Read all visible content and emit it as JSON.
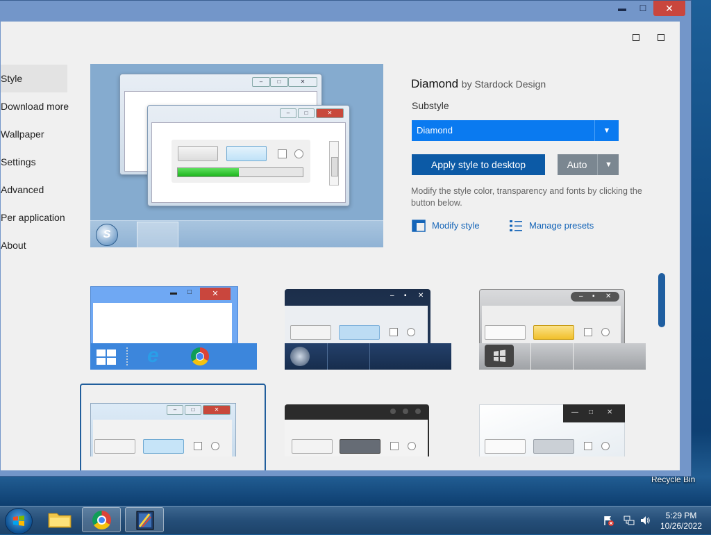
{
  "titlebar": {
    "minimize": "▬",
    "maximize": "☐",
    "close": "✕"
  },
  "sidebar": {
    "items": [
      {
        "label": "Style"
      },
      {
        "label": "Download more"
      },
      {
        "label": "Wallpaper"
      },
      {
        "label": "Settings"
      },
      {
        "label": "Advanced"
      },
      {
        "label": "Per application"
      },
      {
        "label": "About"
      }
    ]
  },
  "details": {
    "style_name": "Diamond",
    "style_author": "by Stardock Design",
    "substyle_label": "Substyle",
    "substyle_value": "Diamond",
    "apply_label": "Apply style to desktop",
    "auto_label": "Auto",
    "description": "Modify the style color, transparency and fonts by clicking the button below.",
    "modify_link": "Modify style",
    "presets_link": "Manage presets"
  },
  "preview": {
    "progress": 0.49
  },
  "desktop": {
    "recycle_bin": "Recycle Bin"
  },
  "taskbar": {
    "time": "5:29 PM",
    "date": "10/26/2022"
  },
  "colors": {
    "accent": "#0a7af0",
    "apply_button": "#0c5aa6",
    "selection_border": "#215e9c"
  }
}
